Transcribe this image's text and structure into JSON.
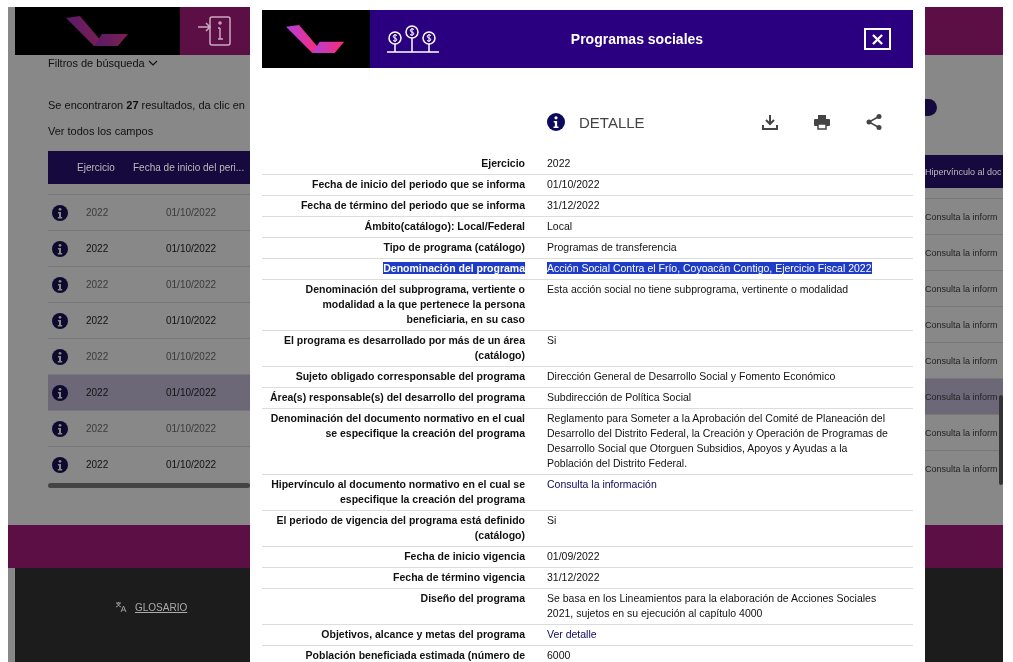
{
  "background": {
    "filters_label": "Filtros de búsqueda",
    "results_text": "Se encontraron **27** resultados, da clic en",
    "all_fields_link": "Ver todos los campos",
    "columns": [
      "Ejercicio",
      "Fecha de inicio del peri...",
      "Hipervínculo al doc"
    ],
    "rows": [
      {
        "year": "2022",
        "date": "01/10/2022",
        "link": "Consulta la inform",
        "selected": false
      },
      {
        "year": "2022",
        "date": "01/10/2022",
        "link": "Consulta la inform",
        "selected": false
      },
      {
        "year": "2022",
        "date": "01/10/2022",
        "link": "Consulta la inform",
        "selected": false
      },
      {
        "year": "2022",
        "date": "01/10/2022",
        "link": "Consulta la inform",
        "selected": false
      },
      {
        "year": "2022",
        "date": "01/10/2022",
        "link": "Consulta la inform",
        "selected": false
      },
      {
        "year": "2022",
        "date": "01/10/2022",
        "link": "Consulta la inform",
        "selected": true
      },
      {
        "year": "2022",
        "date": "01/10/2022",
        "link": "Consulta la inform",
        "selected": false
      },
      {
        "year": "2022",
        "date": "01/10/2022",
        "link": "Consulta la inform",
        "selected": false
      }
    ],
    "footer_link": "GLOSARIO"
  },
  "modal": {
    "title": "Programas sociales",
    "close": "×",
    "section_title": "DETALLE",
    "fields": [
      {
        "label": "Ejercicio",
        "value": "2022",
        "kind": "text",
        "selected": false
      },
      {
        "label": "Fecha de inicio del periodo que se informa",
        "value": "01/10/2022",
        "kind": "text",
        "selected": false
      },
      {
        "label": "Fecha de término del periodo que se informa",
        "value": "31/12/2022",
        "kind": "text",
        "selected": false
      },
      {
        "label": "Ámbito(catálogo): Local/Federal",
        "value": "Local",
        "kind": "text",
        "selected": false
      },
      {
        "label": "Tipo de programa (catálogo)",
        "value": "Programas de transferencia",
        "kind": "text",
        "selected": false
      },
      {
        "label": "Denominación del programa",
        "value": "Acción Social Contra el Frío, Coyoacán Contigo, Ejercicio Fiscal 2022",
        "kind": "text",
        "selected": true
      },
      {
        "label": "Denominación del subprograma, vertiente o modalidad a la que pertenece la persona beneficiaria, en su caso",
        "value": "Esta acción social no tiene subprograma, vertinente o modalidad",
        "kind": "text",
        "selected": false
      },
      {
        "label": "El programa es desarrollado por más de un área (catálogo)",
        "value": "Si",
        "kind": "text",
        "selected": false
      },
      {
        "label": "Sujeto obligado corresponsable del programa",
        "value": "Dirección General de Desarrollo Social y Fomento Económico",
        "kind": "text",
        "selected": false
      },
      {
        "label": "Área(s) responsable(s) del desarrollo del programa",
        "value": "Subdirección de Política Social",
        "kind": "text",
        "selected": false
      },
      {
        "label": "Denominación del documento normativo en el cual se especifique la creación del programa",
        "value": "Reglamento para Someter a la Aprobación del Comité de Planeación del Desarrollo del Distrito Federal, la Creación y Operación de Programas de Desarrollo Social que Otorguen Subsidios, Apoyos y Ayudas a la Población del Distrito Federal.",
        "kind": "text",
        "selected": false
      },
      {
        "label": "Hipervínculo al documento normativo en el cual se especifique la creación del programa",
        "value": "Consulta la información",
        "kind": "link",
        "selected": false
      },
      {
        "label": "El periodo de vigencia del programa está definido (catálogo)",
        "value": "Si",
        "kind": "text",
        "selected": false
      },
      {
        "label": "Fecha de inicio vigencia",
        "value": "01/09/2022",
        "kind": "text",
        "selected": false
      },
      {
        "label": "Fecha de término vigencia",
        "value": "31/12/2022",
        "kind": "text",
        "selected": false
      },
      {
        "label": "Diseño del programa",
        "value": "Se basa en los Lineamientos para la elaboración de Acciones Sociales 2021, sujetos en su ejecución al capítulo 4000",
        "kind": "text",
        "selected": false
      },
      {
        "label": "Objetivos, alcance y metas del programa",
        "value": "Ver detalle",
        "kind": "link",
        "selected": false
      },
      {
        "label": "Población beneficiada estimada (número de",
        "value": "6000",
        "kind": "text",
        "selected": false
      }
    ]
  }
}
